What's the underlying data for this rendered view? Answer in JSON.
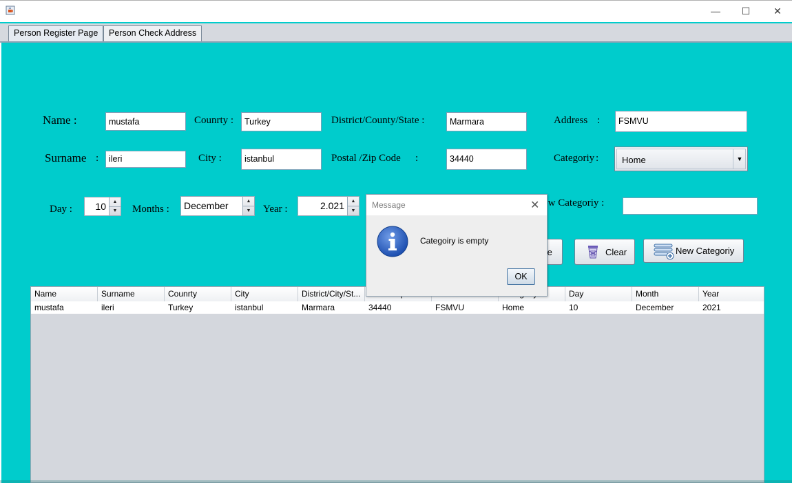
{
  "window": {
    "icon": "java-cup-icon",
    "controls": {
      "minimize": "—",
      "maximize": "☐",
      "close": "✕"
    }
  },
  "tabs": [
    {
      "label": "Person Register Page",
      "selected": true
    },
    {
      "label": "Person Check Address",
      "selected": false
    }
  ],
  "form": {
    "name_label": "Name :",
    "name_value": "mustafa",
    "country_label": "Counrty :",
    "country_value": "Turkey",
    "district_label": "District/County/State :",
    "district_value": "Marmara",
    "address_label": "Address",
    "address_colon": ":",
    "address_value": "FSMVU",
    "surname_label": "Surname",
    "surname_colon": ":",
    "surname_value": "ileri",
    "city_label": "City :",
    "city_value": "istanbul",
    "postal_label": "Postal /Zip Code",
    "postal_colon": ":",
    "postal_value": "34440",
    "category_label": "Categoriy",
    "category_colon": ":",
    "category_selected": "Home",
    "day_label": "Day :",
    "day_value": "10",
    "months_label": "Months :",
    "month_value": "December",
    "year_label": "Year :",
    "year_value": "2.021",
    "new_category_label": "New Categoriy :",
    "new_category_visible_label": "ew Categoriy :",
    "new_category_value": ""
  },
  "buttons": {
    "partial_label": "te",
    "clear": "Clear",
    "new_category": "New Categoriy"
  },
  "table": {
    "columns": [
      "Name",
      "Surname",
      "Counrty",
      "City",
      "District/City/St...",
      "Postal/Zip Cod...",
      "Address",
      "Categoriy",
      "Day",
      "Month",
      "Year"
    ],
    "rows": [
      [
        "mustafa",
        "ileri",
        "Turkey",
        "istanbul",
        "Marmara",
        "34440",
        "FSMVU",
        "Home",
        "10",
        "December",
        "2021"
      ]
    ]
  },
  "dialog": {
    "title": "Message",
    "close_glyph": "✕",
    "message": "Categoiry is empty",
    "ok_label": "OK",
    "icon": "info-icon"
  }
}
